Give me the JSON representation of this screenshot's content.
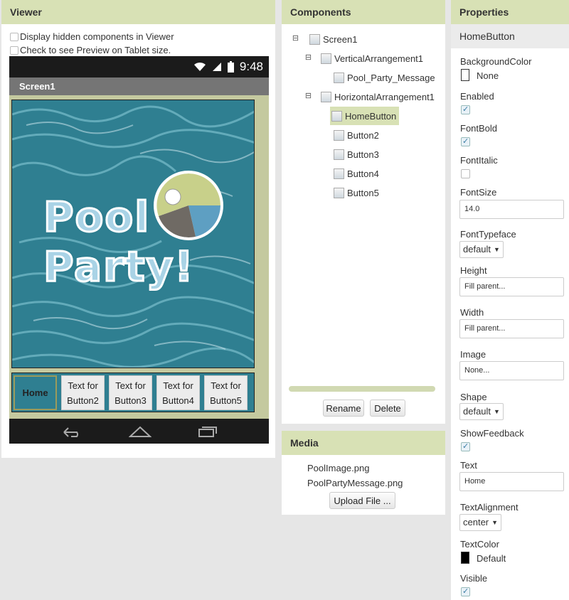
{
  "viewer": {
    "title": "Viewer",
    "hidden_components_label": "Display hidden components in Viewer",
    "tablet_preview_label": "Check to see Preview on Tablet size.",
    "status_time": "9:48",
    "screen_title": "Screen1",
    "image_line1": "Pool",
    "image_line2": "Party!",
    "buttons": [
      "Home",
      "Text for Button2",
      "Text for Button3",
      "Text for Button4",
      "Text for Button5"
    ]
  },
  "components": {
    "title": "Components",
    "tree": [
      {
        "label": "Screen1",
        "toggle": "⊟"
      },
      {
        "label": "VerticalArrangement1",
        "toggle": "⊟"
      },
      {
        "label": "Pool_Party_Message",
        "toggle": ""
      },
      {
        "label": "HorizontalArrangement1",
        "toggle": "⊟"
      },
      {
        "label": "HomeButton",
        "toggle": "",
        "selected": true
      },
      {
        "label": "Button2",
        "toggle": ""
      },
      {
        "label": "Button3",
        "toggle": ""
      },
      {
        "label": "Button4",
        "toggle": ""
      },
      {
        "label": "Button5",
        "toggle": ""
      }
    ],
    "rename_label": "Rename",
    "delete_label": "Delete"
  },
  "media": {
    "title": "Media",
    "files": [
      "PoolImage.png",
      "PoolPartyMessage.png"
    ],
    "upload_label": "Upload File ..."
  },
  "properties": {
    "title": "Properties",
    "component": "HomeButton",
    "background_color": {
      "label": "BackgroundColor",
      "value": "None",
      "color": "#ffffff"
    },
    "enabled": {
      "label": "Enabled",
      "checked": true
    },
    "font_bold": {
      "label": "FontBold",
      "checked": true
    },
    "font_italic": {
      "label": "FontItalic",
      "checked": false
    },
    "font_size": {
      "label": "FontSize",
      "value": "14.0"
    },
    "font_typeface": {
      "label": "FontTypeface",
      "value": "default"
    },
    "height": {
      "label": "Height",
      "value": "Fill parent..."
    },
    "width": {
      "label": "Width",
      "value": "Fill parent..."
    },
    "image": {
      "label": "Image",
      "value": "None..."
    },
    "shape": {
      "label": "Shape",
      "value": "default"
    },
    "show_feedback": {
      "label": "ShowFeedback",
      "checked": true
    },
    "text": {
      "label": "Text",
      "value": "Home"
    },
    "text_alignment": {
      "label": "TextAlignment",
      "value": "center"
    },
    "text_color": {
      "label": "TextColor",
      "value": "Default",
      "color": "#000000"
    },
    "visible": {
      "label": "Visible",
      "checked": true
    }
  },
  "colors": {
    "header_bg": "#d8e1b5",
    "pool_water": "#2f7f91",
    "selected_bg": "#d8e1b5"
  }
}
